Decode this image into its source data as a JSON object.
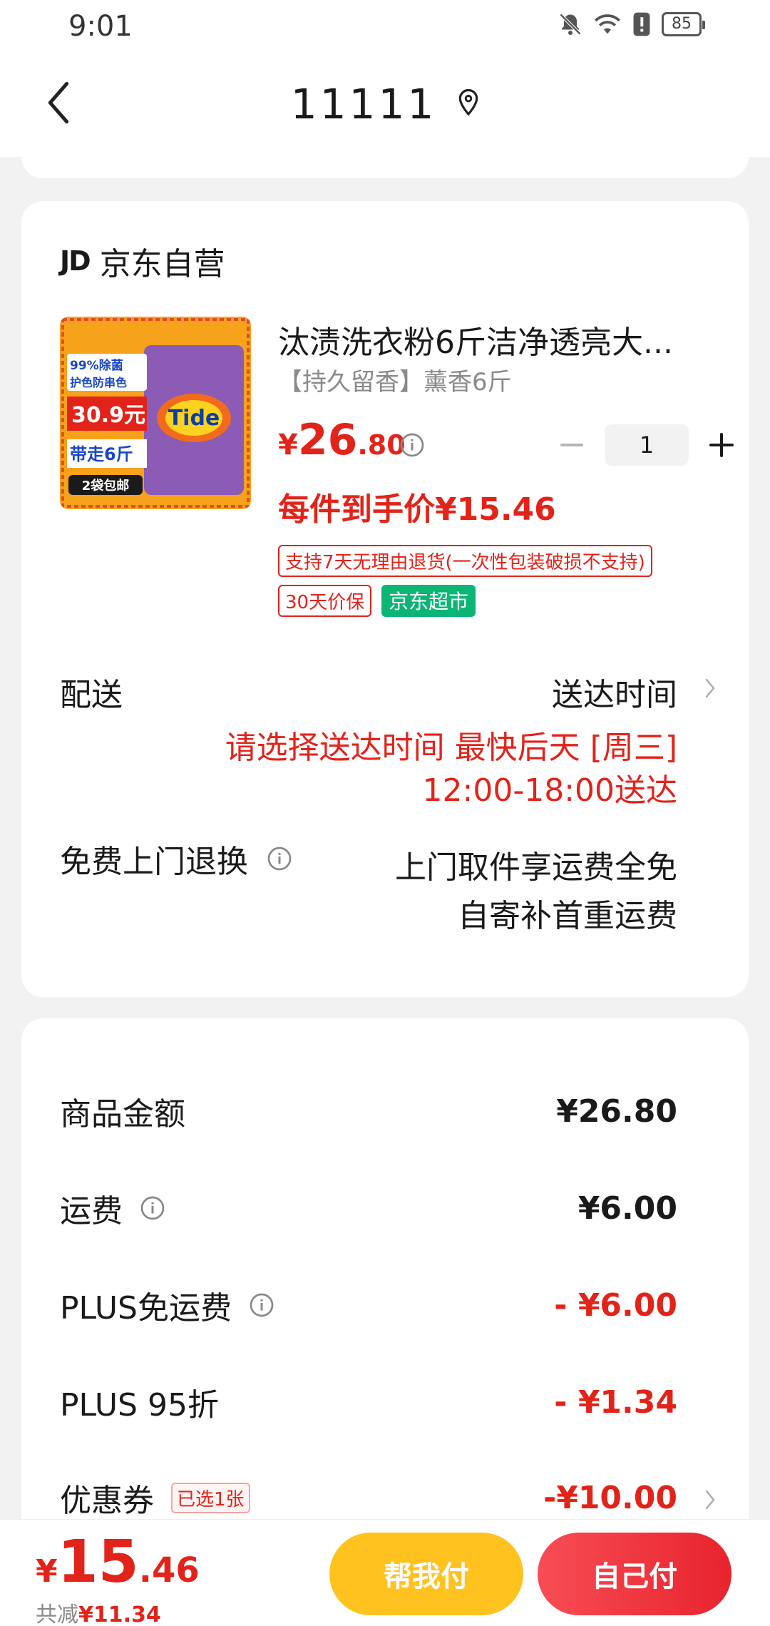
{
  "status_bar": {
    "time": "9:01",
    "battery": "85",
    "icons": [
      "bell-muted-icon",
      "wifi-icon",
      "alert-icon",
      "battery-icon"
    ]
  },
  "nav": {
    "title": "11111",
    "back_icon": "chevron-left-icon",
    "location_icon": "location-pin-icon"
  },
  "shop": {
    "logo": "JD",
    "name": "京东自营"
  },
  "product": {
    "title": "汰渍洗衣粉6斤洁净透亮大...",
    "spec": "【持久留香】薰香6斤",
    "price_yen": "¥",
    "price_int": "26",
    "price_dec": ".80",
    "quantity": "1",
    "unit_price": "每件到手价¥15.46",
    "tag_return": "支持7天无理由退货(一次性包装破损不支持)",
    "tag_price_protect": "30天价保",
    "tag_store": "京东超市",
    "image": {
      "top_line": "99%除菌",
      "second_line": "护色防串色",
      "promo_price": "30.9元",
      "carry": "带走6斤",
      "bundle": "2袋包邮",
      "brand": "Tide"
    }
  },
  "delivery": {
    "label": "配送",
    "time_label": "送达时间",
    "line1": "请选择送达时间  最快后天 [周三]",
    "line2": "12:00-18:00送达"
  },
  "return_service": {
    "label": "免费上门退换",
    "line1": "上门取件享运费全免",
    "line2": "自寄补首重运费"
  },
  "summary": {
    "goods_label": "商品金额",
    "goods_value": "¥26.80",
    "shipping_label": "运费",
    "shipping_value": "¥6.00",
    "plus_free_label": "PLUS免运费",
    "plus_free_value": "- ¥6.00",
    "plus_discount_label": "PLUS 95折",
    "plus_discount_value": "- ¥1.34",
    "coupon_label": "优惠券",
    "coupon_badge": "已选1张",
    "coupon_value": "-¥10.00"
  },
  "bottom": {
    "total_yen": "¥",
    "total_int": "15",
    "total_dec": ".46",
    "saved_label": "共减",
    "saved_value": "¥11.34",
    "help_pay": "帮我付",
    "self_pay": "自己付"
  },
  "colors": {
    "accent_red": "#e2231a",
    "yellow_button": "#ffc21f",
    "green_tag": "#0bb576"
  }
}
